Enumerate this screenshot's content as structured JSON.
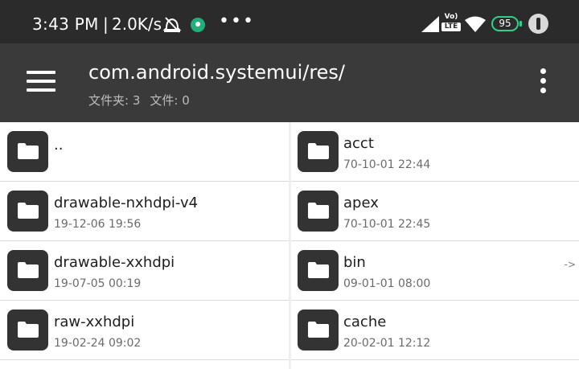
{
  "status_bar": {
    "time": "3:43 PM",
    "separator": "|",
    "net_rate": "2.0K/s",
    "more": "•••",
    "volte_top": "Vo)",
    "volte_bottom": "LTE",
    "battery": "95",
    "icons": [
      "alarm-off-icon",
      "vpn-icon",
      "signal-icon",
      "wifi-icon",
      "battery-icon",
      "user-icon"
    ],
    "battery_color": "#2fd089"
  },
  "app_bar": {
    "path": "com.android.systemui/res/",
    "folders_label": "文件夹: 3",
    "files_label": "文件: 0"
  },
  "left_pane": {
    "items": [
      {
        "name": "..",
        "date": ""
      },
      {
        "name": "drawable-nxhdpi-v4",
        "date": "19-12-06 19:56"
      },
      {
        "name": "drawable-xxhdpi",
        "date": "19-07-05 00:19"
      },
      {
        "name": "raw-xxhdpi",
        "date": "19-02-24 09:02"
      }
    ]
  },
  "right_pane": {
    "items": [
      {
        "name": "acct",
        "date": "70-10-01 22:44",
        "link": ""
      },
      {
        "name": "apex",
        "date": "70-10-01 22:45",
        "link": ""
      },
      {
        "name": "bin",
        "date": "09-01-01 08:00",
        "link": "->"
      },
      {
        "name": "cache",
        "date": "20-02-01 12:12",
        "link": ""
      }
    ]
  },
  "colors": {
    "status_bar_bg": "#2b2b2b",
    "app_bar_bg": "#3a3a3a",
    "folder_icon_bg": "#333333",
    "divider": "#dcdcdc"
  }
}
